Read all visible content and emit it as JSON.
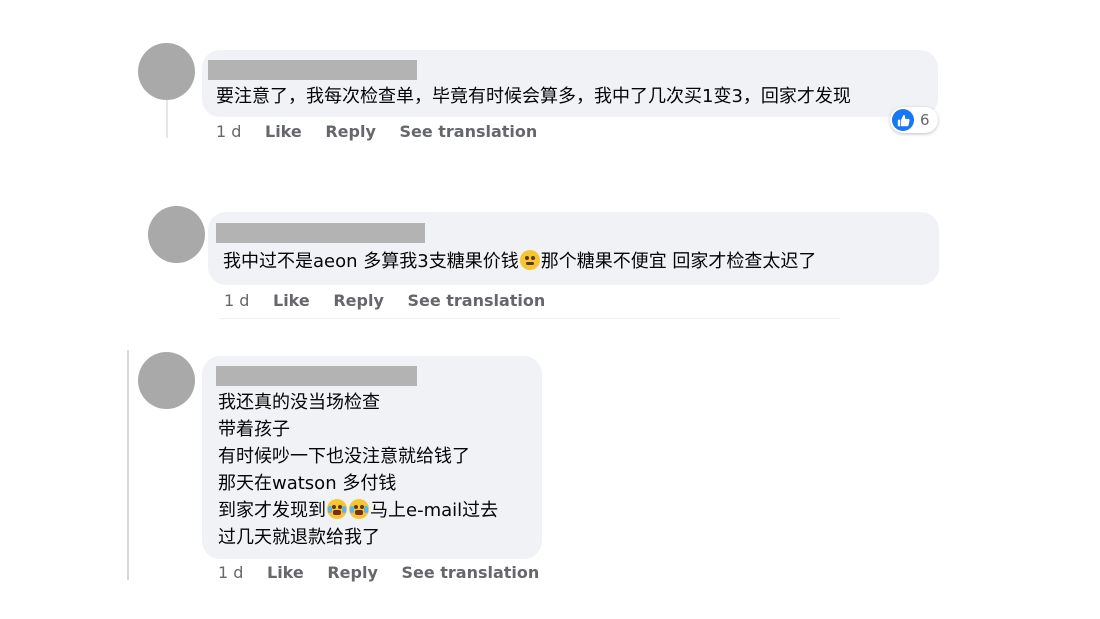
{
  "comments": [
    {
      "text": "要注意了，我每次检查单，毕竟有时候会算多，我中了几次买1变3，回家才发现",
      "actions": {
        "time": "1 d",
        "like": "Like",
        "reply": "Reply",
        "translate": "See translation"
      },
      "reaction": {
        "icon": "like-icon",
        "count": "6",
        "color": "#1877f2"
      }
    },
    {
      "text_before": "我中过不是aeon 多算我3支糖果价钱",
      "emoji": "rolling-eyes-emoji",
      "text_after": "那个糖果不便宜 回家才检查太迟了",
      "actions": {
        "time": "1 d",
        "like": "Like",
        "reply": "Reply",
        "translate": "See translation"
      }
    },
    {
      "lines": [
        "我还真的没当场检查",
        "带着孩子",
        "有时候吵一下也没注意就给钱了",
        "那天在watson 多付钱"
      ],
      "line5_before": "到家才发现到",
      "line5_emoji": "crying-laughing-emoji",
      "line5_after": "马上e-mail过去",
      "line6": "过几天就退款给我了",
      "actions": {
        "time": "1 d",
        "like": "Like",
        "reply": "Reply",
        "translate": "See translation"
      }
    }
  ],
  "colors": {
    "bubble": "#f0f2f5",
    "avatar": "#a9a9a9",
    "name_redaction": "#b3b3b3",
    "meta": "#65676b"
  }
}
